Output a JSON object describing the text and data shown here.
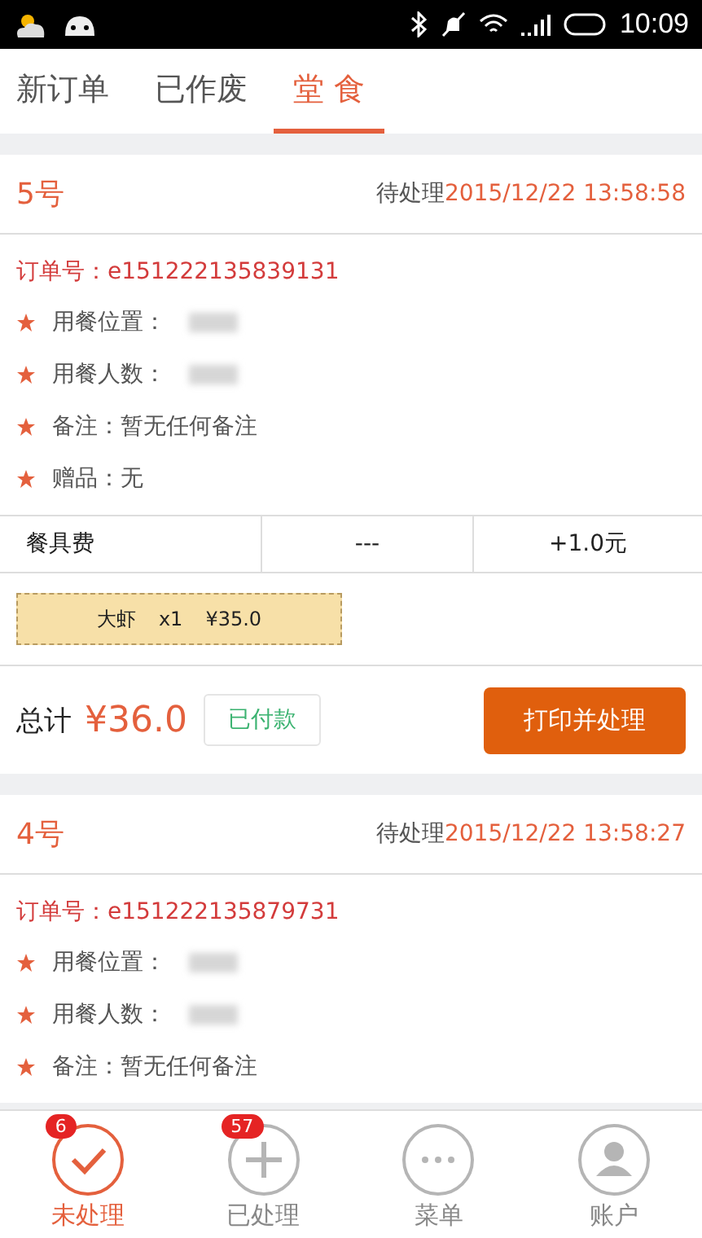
{
  "status_bar": {
    "time": "10:09"
  },
  "tabs": [
    {
      "label": "新订单",
      "selected": false
    },
    {
      "label": "已作废",
      "selected": false
    },
    {
      "label": "堂 食",
      "selected": true
    }
  ],
  "orders": [
    {
      "number": "5号",
      "status": "待处理",
      "time": "2015/12/22 13:58:58",
      "order_no": "订单号：e151222135839131",
      "details": [
        {
          "kind": "blurred",
          "text": "用餐位置："
        },
        {
          "kind": "blurred",
          "text": "用餐人数："
        },
        {
          "kind": "text",
          "text": "备注：暂无任何备注"
        },
        {
          "kind": "text",
          "text": "赠品：无"
        }
      ],
      "fee": {
        "name": "餐具费",
        "quantity": "---",
        "amount": "+1.0元"
      },
      "items": [
        {
          "name": "大虾",
          "qty": "x1",
          "price": "¥35.0"
        }
      ],
      "total_label": "总计",
      "total": "¥36.0",
      "payment": "已付款",
      "action": "打印并处理"
    },
    {
      "number": "4号",
      "status": "待处理",
      "time": "2015/12/22 13:58:27",
      "order_no": "订单号：e151222135879731",
      "details": [
        {
          "kind": "blurred",
          "text": "用餐位置："
        },
        {
          "kind": "blurred",
          "text": "用餐人数："
        },
        {
          "kind": "text",
          "text": "备注：暂无任何备注"
        }
      ]
    }
  ],
  "bottom_nav": [
    {
      "kind": "check",
      "label": "未处理",
      "badge": "6",
      "selected": true
    },
    {
      "kind": "plus",
      "label": "已处理",
      "badge": "57",
      "selected": false
    },
    {
      "kind": "dots",
      "label": "菜单",
      "selected": false
    },
    {
      "kind": "person",
      "label": "账户",
      "selected": false
    }
  ]
}
